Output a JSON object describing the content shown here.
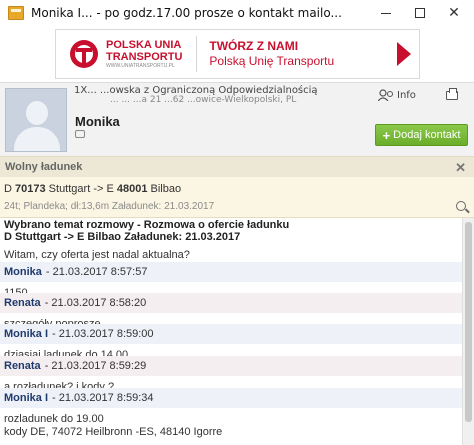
{
  "window": {
    "title": "Monika I... - po godz.17.00 prosze o kontakt mailo...",
    "controls": {
      "minimize": "",
      "maximize": "",
      "close": "✕"
    }
  },
  "banner": {
    "brand_line1": "POLSKA UNIA",
    "brand_line2": "TRANSPORTU",
    "brand_url": "WWW.UNIATRANSPORTU.PL",
    "slogan_line1": "TWÓRZ Z NAMI",
    "slogan_line2": "Polską Unię Transportu",
    "colors": {
      "accent": "#c8102e"
    }
  },
  "contact": {
    "company_line": "1X... ...owska z Ograniczoną Odpowiedzialnością",
    "company_line2": "... ... ...a 21 ...62 ...owice-Wielkopolski, PL",
    "info_label": "Info",
    "name": "Monika",
    "add_button_label": "Dodaj kontakt"
  },
  "load": {
    "title": "Wolny ładunek",
    "route": {
      "from_country": "D",
      "from_code": "70173",
      "from_city": "Stuttgart",
      "arrow": "->",
      "to_country": "E",
      "to_code": "48001",
      "to_city": "Bilbao"
    },
    "details": "24t; Plandeka; dł:13,6m    Załadunek: 21.03.2017"
  },
  "chat": {
    "topic_line1": "Wybrano temat rozmowy - Rozmowa o ofercie ładunku",
    "topic_line2": "D Stuttgart -> E Bilbao Załadunek: 21.03.2017",
    "first_message": "Witam, czy oferta jest nadal aktualna?",
    "messages": [
      {
        "author": "Monika",
        "time": "- 21.03.2017 8:57:57",
        "text": "1150",
        "kind": "a"
      },
      {
        "author": "Renata",
        "time": "- 21.03.2017 8:58:20",
        "text": "szczegóły poproszę",
        "kind": "b"
      },
      {
        "author": "Monika I",
        "time": "- 21.03.2017 8:59:00",
        "text": "dziasiaj ladunek do 14.00",
        "kind": "a"
      },
      {
        "author": "Renata",
        "time": "- 21.03.2017 8:59:29",
        "text": "a rozładunek? i kody ?",
        "kind": "b"
      },
      {
        "author": "Monika I",
        "time": "- 21.03.2017 8:59:34",
        "text": "rozladunek do 19.00",
        "text2": "kody DE, 74072 Heilbronn -ES, 48140 Igorre",
        "kind": "a"
      }
    ]
  }
}
